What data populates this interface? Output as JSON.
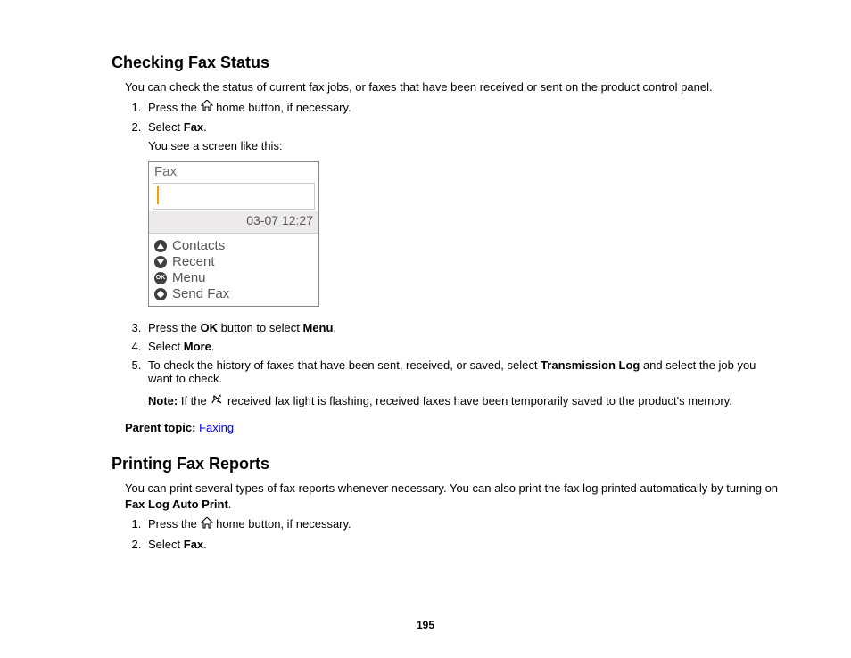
{
  "page_number": "195",
  "section1": {
    "heading": "Checking Fax Status",
    "intro": "You can check the status of current fax jobs, or faxes that have been received or sent on the product control panel.",
    "step1_pre": "Press the ",
    "step1_post": " home button, if necessary.",
    "step2_pre": "Select ",
    "step2_bold": "Fax",
    "step2_post": ".",
    "step2_sub": "You see a screen like this:",
    "fax_screen": {
      "title": "Fax",
      "datetime": "03-07 12:27",
      "items": {
        "contacts": "Contacts",
        "recent": "Recent",
        "menu": "Menu",
        "send": "Send Fax"
      }
    },
    "step3_a": "Press the ",
    "step3_b": "OK",
    "step3_c": " button to select ",
    "step3_d": "Menu",
    "step3_e": ".",
    "step4_a": "Select ",
    "step4_b": "More",
    "step4_c": ".",
    "step5_a": "To check the history of faxes that have been sent, received, or saved, select ",
    "step5_b": "Transmission Log",
    "step5_c": " and select the job you want to check.",
    "note_label": "Note:",
    "note_a": " If the ",
    "note_b": " received fax light is flashing, received faxes have been temporarily saved to the product's memory.",
    "parent_label": "Parent topic: ",
    "parent_link": "Faxing"
  },
  "section2": {
    "heading": "Printing Fax Reports",
    "intro_a": "You can print several types of fax reports whenever necessary. You can also print the fax log printed automatically by turning on ",
    "intro_b": "Fax Log Auto Print",
    "intro_c": ".",
    "step1_pre": "Press the ",
    "step1_post": " home button, if necessary.",
    "step2_pre": "Select ",
    "step2_bold": "Fax",
    "step2_post": "."
  }
}
